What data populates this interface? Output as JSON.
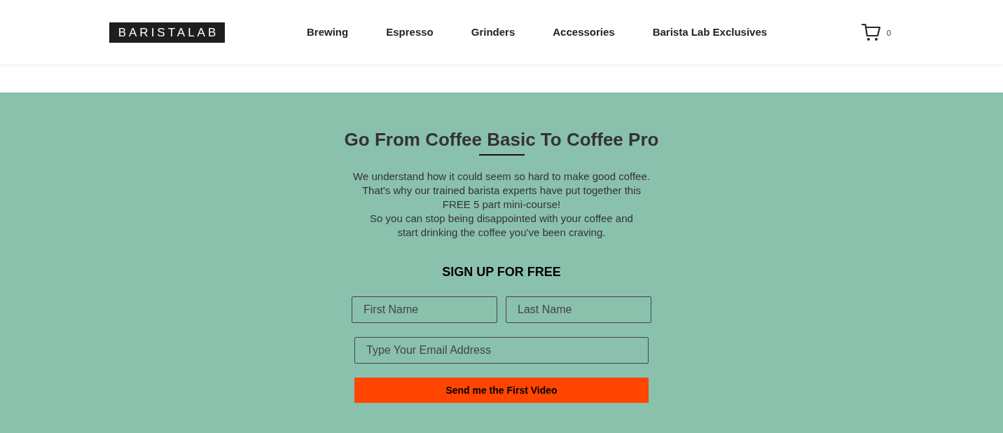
{
  "header": {
    "logo": "BARISTALAB",
    "nav": [
      "Brewing",
      "Espresso",
      "Grinders",
      "Accessories",
      "Barista Lab Exclusives"
    ],
    "cart": {
      "count": "0"
    }
  },
  "signup": {
    "title": "Go From Coffee Basic To Coffee Pro",
    "description": [
      "We understand how it could seem so hard to make good coffee.",
      "That's why our trained barista experts have put together this",
      "FREE 5 part mini-course!",
      "So you can stop being disappointed with your coffee and",
      "start drinking the coffee you've been craving."
    ],
    "form_title": "SIGN UP FOR FREE",
    "name_fields": [
      {
        "placeholder": "First Name"
      },
      {
        "placeholder": "Last Name"
      }
    ],
    "email_field": {
      "placeholder": "Type Your Email Address"
    },
    "submit": "Send me the First Video"
  }
}
